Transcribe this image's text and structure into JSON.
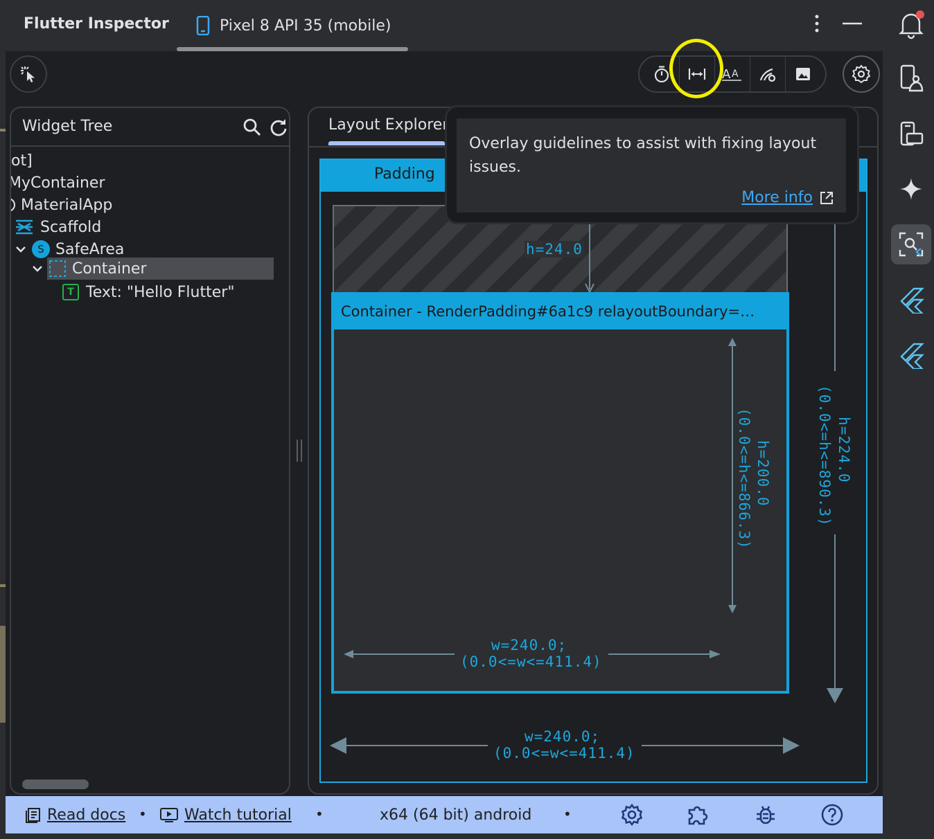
{
  "app_title": "Flutter Inspector",
  "device_tab": {
    "label": "Pixel 8 API 35 (mobile)",
    "icon": "phone-icon"
  },
  "window_controls": {
    "more": "more-vert-icon",
    "minimize": "minimize-icon"
  },
  "toolbar": {
    "select_mode": "select-widget-mode-icon",
    "toggles": [
      "slow-animations-icon",
      "layout-guidelines-icon",
      "text-baselines-icon",
      "repaint-rainbow-icon",
      "oversized-images-icon"
    ],
    "settings": "gear-icon"
  },
  "widget_tree": {
    "title": "Widget Tree",
    "rows": [
      {
        "label": "ot]"
      },
      {
        "label": "MyContainer"
      },
      {
        "label": "MaterialApp"
      },
      {
        "label": "Scaffold"
      },
      {
        "label": "SafeArea",
        "badge": "S"
      },
      {
        "label": "Container"
      },
      {
        "label": "Text: \"Hello Flutter\"",
        "badge": "T"
      }
    ]
  },
  "layout_explorer": {
    "tab_label": "Layout Explorer",
    "outer_header": "Padding",
    "inner_header": "Container - RenderPadding#6a1c9 relayoutBoundary=…",
    "padding_height": "h=24.0",
    "inner_height": [
      "h=200.0",
      "(0.0<=h<=866.3)"
    ],
    "inner_width": [
      "w=240.0;",
      "(0.0<=w<=411.4)"
    ],
    "outer_height": [
      "h=224.0",
      "(0.0<=h<=890.3)"
    ],
    "outer_width": [
      "w=240.0;",
      "(0.0<=w<=411.4)"
    ]
  },
  "tooltip": {
    "text": "Overlay guidelines to assist with fixing layout issues.",
    "link": "More info"
  },
  "status_bar": {
    "read_docs": "Read docs",
    "watch_tutorial": "Watch tutorial",
    "platform": "x64 (64 bit) android",
    "icons": [
      "gear-icon",
      "extension-icon",
      "bug-icon",
      "help-icon"
    ]
  },
  "right_sidebar": [
    "notifications-icon",
    "device-manager-icon",
    "running-devices-icon",
    "gemini-icon",
    "layout-inspector-icon",
    "flutter-outline-icon",
    "flutter-performance-icon"
  ],
  "colors": {
    "accent": "#13a3dc",
    "highlight": "#f2ee00",
    "status_bar": "#a8c4f8",
    "link": "#3ea8f5"
  }
}
